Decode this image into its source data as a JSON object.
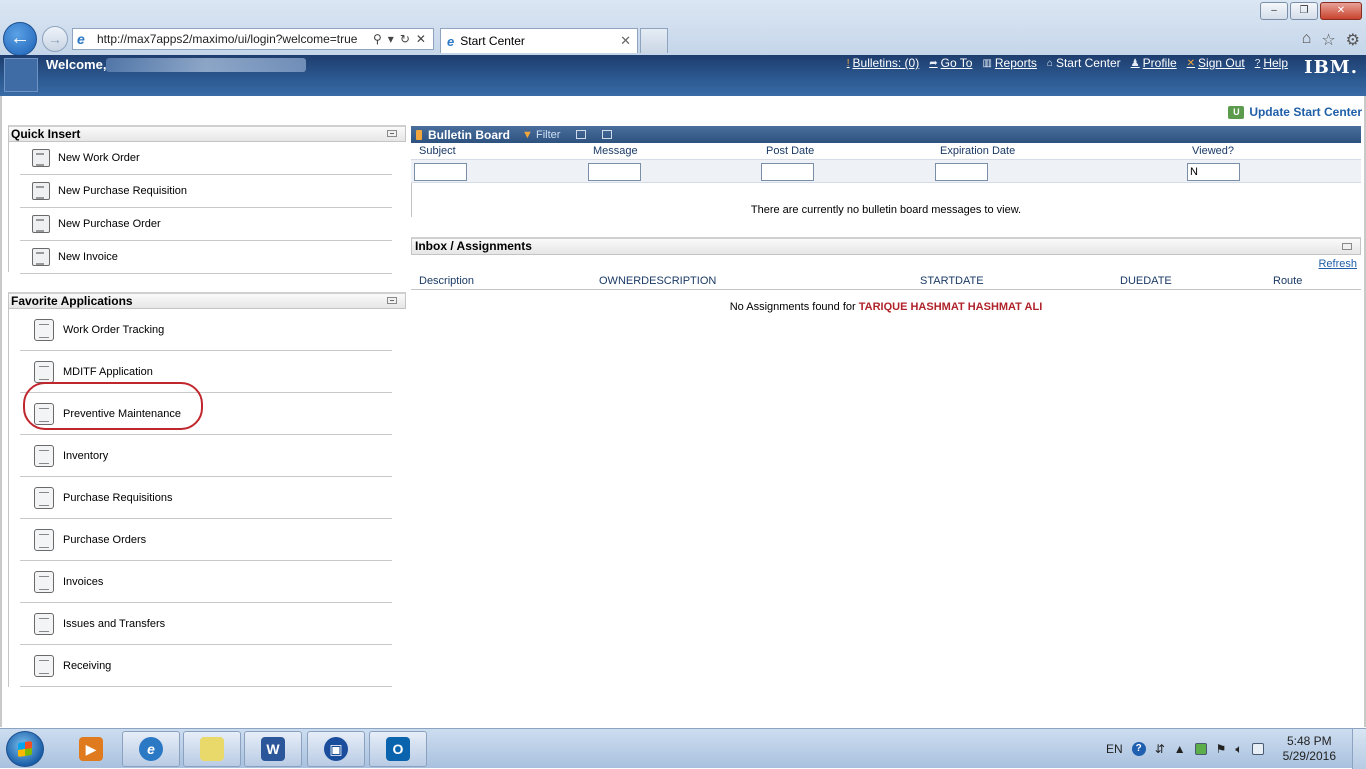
{
  "browser": {
    "window_controls": [
      "–",
      "❐",
      "✕"
    ],
    "url": "http://max7apps2/maximo/ui/login?welcome=true",
    "tab_title": "Start Center"
  },
  "header": {
    "welcome": "Welcome,",
    "links": [
      {
        "label": "Bulletins: (0)",
        "icon": "bulletin-warning-icon"
      },
      {
        "label": "Go To",
        "icon": "goto-arrow-icon"
      },
      {
        "label": "Reports",
        "icon": "reports-chart-icon"
      },
      {
        "label": "Start Center",
        "icon": "home-icon"
      },
      {
        "label": "Profile",
        "icon": "person-icon"
      },
      {
        "label": "Sign Out",
        "icon": "sign-out-x-icon"
      },
      {
        "label": "Help",
        "icon": "help-question-icon"
      }
    ],
    "brand": "IBM."
  },
  "update_start_center": "Update Start Center",
  "quick_insert": {
    "title": "Quick Insert",
    "items": [
      "New Work Order",
      "New Purchase Requisition",
      "New Purchase Order",
      "New Invoice"
    ]
  },
  "favorite_applications": {
    "title": "Favorite Applications",
    "items": [
      "Work Order Tracking",
      "MDITF Application",
      "Preventive Maintenance",
      "Inventory",
      "Purchase Requisitions",
      "Purchase Orders",
      "Invoices",
      "Issues and Transfers",
      "Receiving"
    ]
  },
  "bulletin_board": {
    "title": "Bulletin Board",
    "filter_label": "Filter",
    "columns": [
      "Subject",
      "Message",
      "Post Date",
      "Expiration Date",
      "Viewed?"
    ],
    "filter_values": [
      "",
      "",
      "",
      "",
      "N"
    ],
    "empty_message": "There are currently no bulletin board messages to view."
  },
  "inbox": {
    "title": "Inbox / Assignments",
    "refresh": "Refresh",
    "columns": [
      "Description",
      "OWNERDESCRIPTION",
      "STARTDATE",
      "DUEDATE",
      "Route"
    ],
    "empty_prefix": "No Assignments found for",
    "user_name": "TARIQUE HASHMAT HASHMAT ALI"
  },
  "taskbar": {
    "language": "EN",
    "time": "5:48 PM",
    "date": "5/29/2016"
  }
}
